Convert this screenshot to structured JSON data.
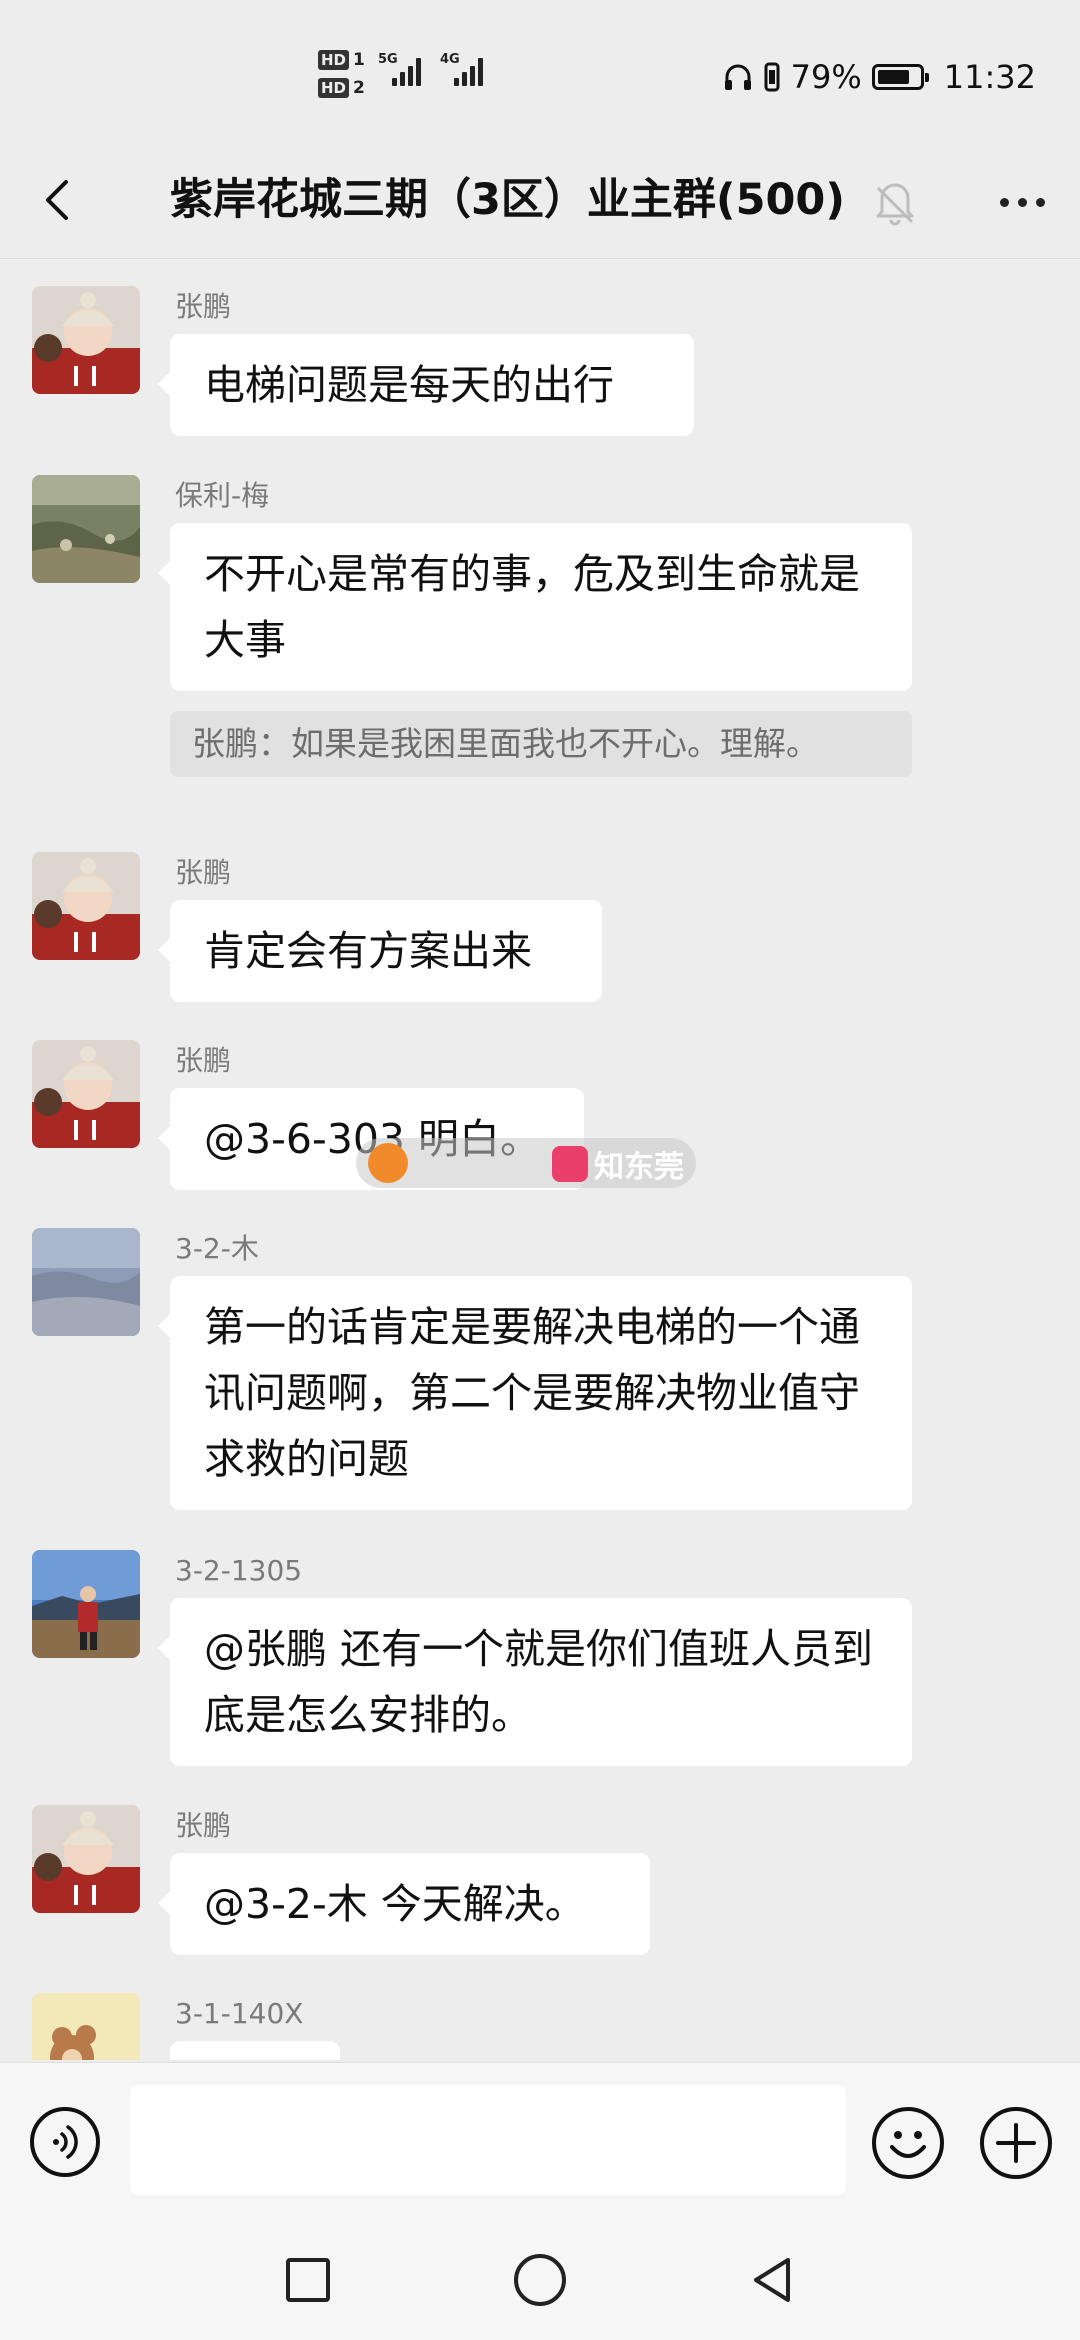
{
  "status_bar": {
    "hd1": "HD",
    "hd1_num": "1",
    "hd2": "HD",
    "hd2_num": "2",
    "net1": "5G",
    "net2": "4G",
    "battery_percent": "79%",
    "battery_level": 0.79,
    "time": "11:32",
    "icons": [
      "headphones-icon",
      "vibrate-icon",
      "battery-icon",
      "signal-icon"
    ]
  },
  "header": {
    "title": "紫岸花城三期（3区）业主群(500)",
    "icons": [
      "back-icon",
      "mute-bell-icon",
      "more-icon"
    ]
  },
  "messages": [
    {
      "sender": "张鹏",
      "text": "电梯问题是每天的出行"
    },
    {
      "sender": "保利-梅",
      "text": "不开心是常有的事，危及到生命就是大事",
      "quote": "张鹏：如果是我困里面我也不开心。理解。"
    },
    {
      "sender": "张鹏",
      "text": "肯定会有方案出来"
    },
    {
      "sender": "张鹏",
      "text": "@3-6-303  明白。"
    },
    {
      "sender": "3-2-木",
      "text": "第一的话肯定是要解决电梯的一个通讯问题啊，第二个是要解决物业值守求救的问题"
    },
    {
      "sender": "3-2-1305",
      "text": "@张鹏  还有一个就是你们值班人员到底是怎么安排的。"
    },
    {
      "sender": "张鹏",
      "text": "@3-2-木  今天解决。"
    },
    {
      "sender": "3-1-140X",
      "text": ""
    }
  ],
  "watermark": {
    "text": "知东莞"
  },
  "input_bar": {
    "placeholder": "",
    "icons": [
      "voice-icon",
      "emoji-icon",
      "plus-icon"
    ]
  },
  "nav_bar": {
    "icons": [
      "recent-apps-icon",
      "home-icon",
      "back-nav-icon"
    ]
  },
  "colors": {
    "background": "#ededed",
    "bubble": "#ffffff",
    "quote": "#e1e1e1",
    "sender": "#7a7a7a"
  }
}
